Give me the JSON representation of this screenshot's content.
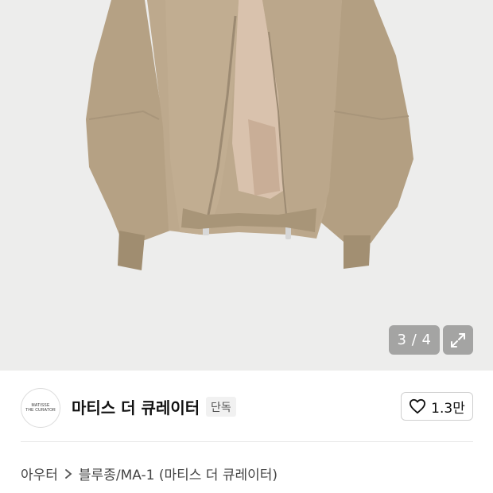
{
  "gallery": {
    "image_alt": "beige MA-1 jacket",
    "counter": "3 / 4",
    "expand_icon": "expand-icon"
  },
  "brand": {
    "logo_line1": "MATISSE",
    "logo_line2": "THE CURATOR",
    "name": "마티스 더 큐레이터",
    "badge": "단독"
  },
  "like": {
    "icon": "heart-icon",
    "count": "1.3만"
  },
  "breadcrumb": {
    "category": "아우터",
    "separator_icon": "chevron-right-icon",
    "subcategory": "블루종/MA-1 (마티스 더 큐레이터)"
  },
  "colors": {
    "jacket": "#bda98d",
    "lining": "#d9c2ad",
    "background": "#ededec"
  }
}
